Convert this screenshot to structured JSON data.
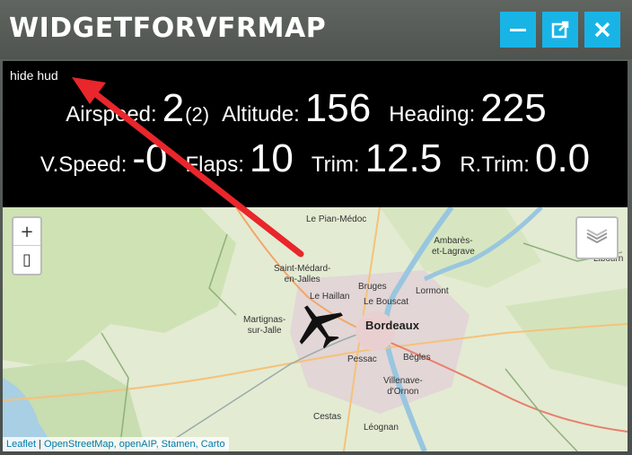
{
  "window": {
    "title": "WIDGETFORVFRMAP",
    "minimize_icon": "minimize-icon",
    "popout_icon": "popout-icon",
    "close_icon": "close-icon"
  },
  "hud": {
    "hide_label": "hide hud",
    "airspeed": {
      "label": "Airspeed:",
      "value": "2",
      "sub": "(2)"
    },
    "altitude": {
      "label": "Altitude:",
      "value": "156"
    },
    "heading": {
      "label": "Heading:",
      "value": "225"
    },
    "vspeed": {
      "label": "V.Speed:",
      "value": "-0"
    },
    "flaps": {
      "label": "Flaps:",
      "value": "10"
    },
    "trim": {
      "label": "Trim:",
      "value": "12.5"
    },
    "rtrim": {
      "label": "R.Trim:",
      "value": "0.0"
    }
  },
  "map": {
    "zoom_in": "+",
    "zoom_out": "▯",
    "layers_icon": "layers-icon",
    "places": {
      "le_pian_medoc": "Le Pian-Médoc",
      "ambares": "Ambarès-\net-Lagrave",
      "libourne": "Libourn",
      "saint_medard": "Saint-Médard-\nen-Jalles",
      "le_haillan": "Le Haillan",
      "bruges": "Bruges",
      "lormont": "Lormont",
      "le_bouscat": "Le Bouscat",
      "bordeaux": "Bordeaux",
      "martignas": "Martignas-\nsur-Jalle",
      "pessac": "Pessac",
      "begles": "Bègles",
      "villenave": "Villenave-\nd'Ornon",
      "cestas": "Cestas",
      "leognan": "Léognan"
    },
    "attribution": {
      "leaflet": "Leaflet",
      "sep": " | ",
      "sources": "OpenStreetMap, openAIP, Stamen, Carto"
    },
    "aircraft_icon": "aircraft-icon"
  },
  "colors": {
    "accent": "#19b4e6",
    "arrow": "#e8262b"
  }
}
